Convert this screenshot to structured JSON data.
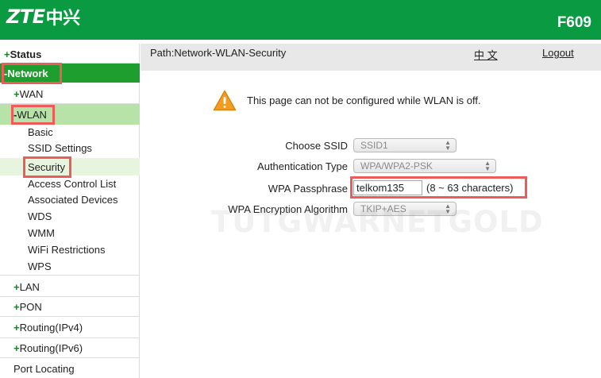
{
  "header": {
    "logo_latin": "ZTE",
    "logo_cn": "中兴",
    "model": "F609"
  },
  "sidebar": {
    "status": {
      "sign": "+",
      "label": "Status"
    },
    "network": {
      "sign": "-",
      "label": "Network"
    },
    "wan": {
      "sign": "+",
      "label": "WAN"
    },
    "wlan": {
      "sign": "-",
      "label": "WLAN"
    },
    "wlan_items": [
      "Basic",
      "SSID Settings",
      "Security",
      "Access Control List",
      "Associated Devices",
      "WDS",
      "WMM",
      "WiFi Restrictions",
      "WPS"
    ],
    "lan": {
      "sign": "+",
      "label": "LAN"
    },
    "pon": {
      "sign": "+",
      "label": "PON"
    },
    "routing4": {
      "sign": "+",
      "label": "Routing(IPv4)"
    },
    "routing6": {
      "sign": "+",
      "label": "Routing(IPv6)"
    },
    "port_locating": "Port Locating"
  },
  "pathbar": {
    "path": "Path:Network-WLAN-Security",
    "language": "中 文",
    "logout": "Logout"
  },
  "notice": "This page can not be configured while WLAN is off.",
  "form": {
    "ssid_label": "Choose SSID",
    "ssid_value": "SSID1",
    "auth_label": "Authentication Type",
    "auth_value": "WPA/WPA2-PSK",
    "pass_label": "WPA Passphrase",
    "pass_value": "telkom135",
    "pass_hint": "(8 ~ 63 characters)",
    "enc_label": "WPA Encryption Algorithm",
    "enc_value": "TKIP+AES"
  },
  "watermark": "TUTGWARNETGOLD",
  "colors": {
    "header_green": "#0a9a41",
    "selected_green": "#1e9e2e",
    "wlan_green": "#b8e3a8",
    "highlight_red": "#ef5b5b"
  }
}
